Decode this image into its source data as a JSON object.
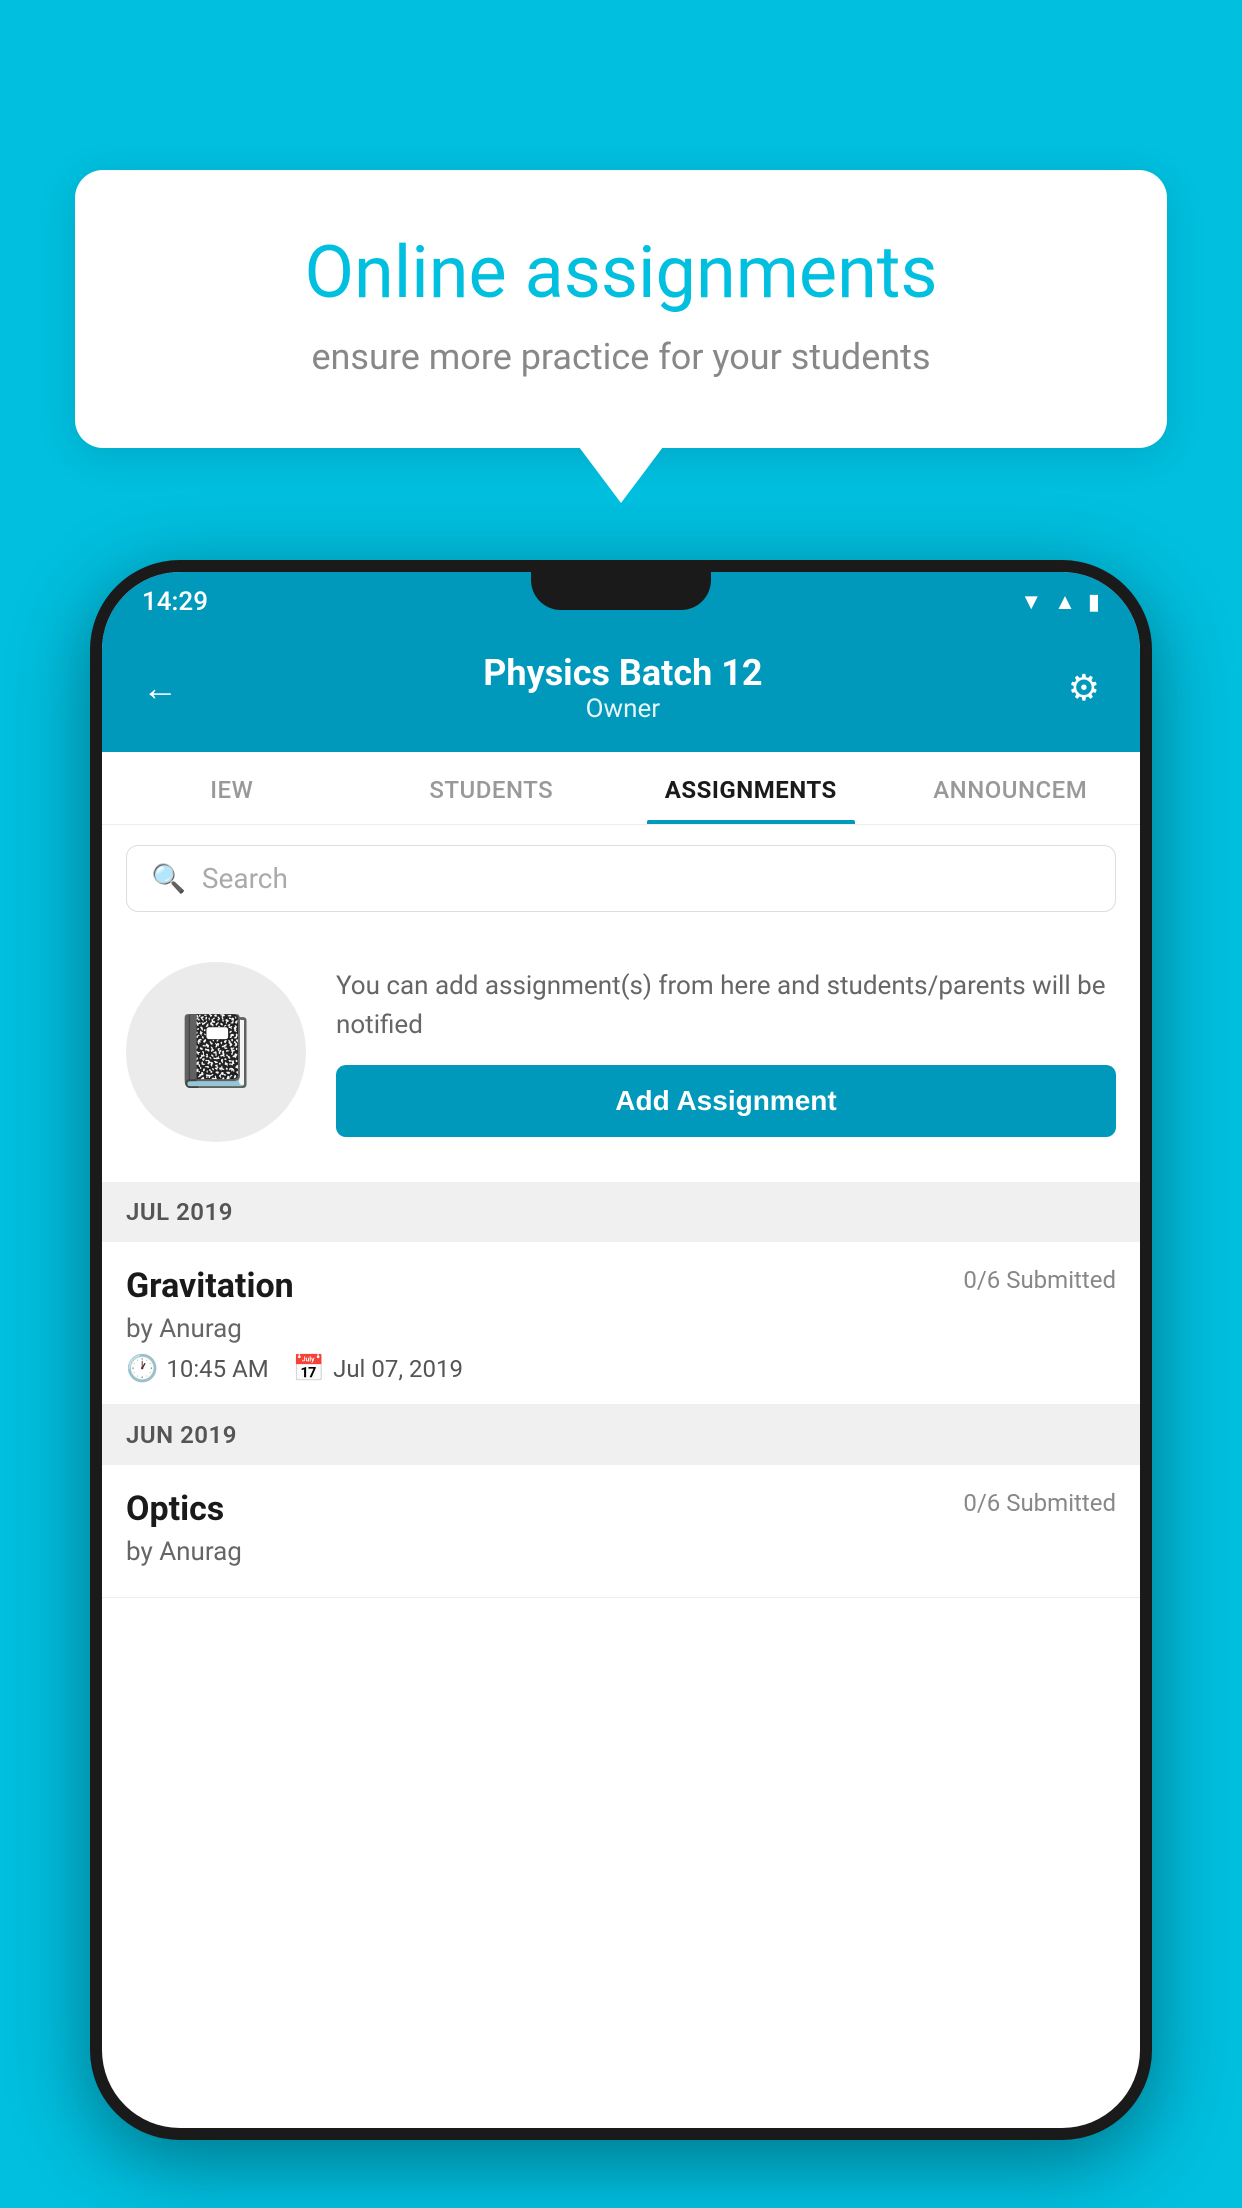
{
  "background": {
    "color": "#00BFDF"
  },
  "speech_bubble": {
    "title": "Online assignments",
    "subtitle": "ensure more practice for your students"
  },
  "status_bar": {
    "time": "14:29",
    "wifi_icon": "wifi",
    "signal_icon": "signal",
    "battery_icon": "battery"
  },
  "app_header": {
    "back_label": "←",
    "title": "Physics Batch 12",
    "subtitle": "Owner",
    "gear_icon": "⚙"
  },
  "tabs": [
    {
      "label": "IEW",
      "active": false
    },
    {
      "label": "STUDENTS",
      "active": false
    },
    {
      "label": "ASSIGNMENTS",
      "active": true
    },
    {
      "label": "ANNOUNCEM",
      "active": false
    }
  ],
  "search": {
    "placeholder": "Search"
  },
  "promo": {
    "description": "You can add assignment(s) from here and students/parents will be notified",
    "button_label": "Add Assignment"
  },
  "sections": [
    {
      "header": "JUL 2019",
      "assignments": [
        {
          "title": "Gravitation",
          "submitted": "0/6 Submitted",
          "author": "by Anurag",
          "time": "10:45 AM",
          "date": "Jul 07, 2019"
        }
      ]
    },
    {
      "header": "JUN 2019",
      "assignments": [
        {
          "title": "Optics",
          "submitted": "0/6 Submitted",
          "author": "by Anurag",
          "time": "",
          "date": ""
        }
      ]
    }
  ]
}
